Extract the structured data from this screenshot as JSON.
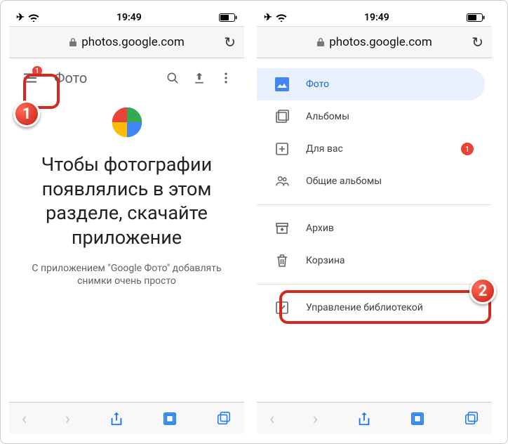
{
  "status_bar": {
    "time": "19:49"
  },
  "browser": {
    "url": "photos.google.com"
  },
  "left": {
    "app_bar": {
      "title": "Фото",
      "badge": "1"
    },
    "promo": {
      "title": "Чтобы фотографии появлялись в этом разделе, скачайте приложение",
      "subtitle": "С приложением \"Google Фото\" добавлять снимки очень просто"
    }
  },
  "right": {
    "drawer": {
      "photos": "Фото",
      "albums": "Альбомы",
      "for_you": "Для вас",
      "for_you_badge": "1",
      "shared": "Общие альбомы",
      "archive": "Архив",
      "trash": "Корзина",
      "manage": "Управление библиотекой"
    }
  },
  "annotations": {
    "step1": "1",
    "step2": "2"
  }
}
